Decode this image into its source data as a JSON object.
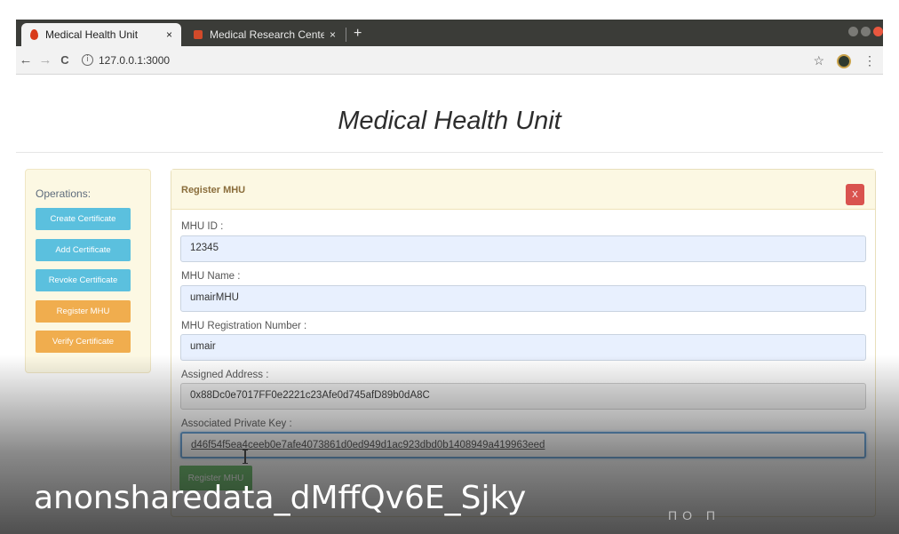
{
  "browser": {
    "tabs": [
      {
        "label": "Medical Health Unit",
        "close": "×",
        "active": true
      },
      {
        "label": "Medical Research Center",
        "close": "×",
        "active": false
      }
    ],
    "new_tab": "+",
    "url": "127.0.0.1:3000",
    "back": "←",
    "forward": "→",
    "reload": "C",
    "info": "i",
    "bookmark": "☆",
    "menu": "⋮"
  },
  "page": {
    "title": "Medical Health Unit"
  },
  "operations": {
    "label": "Operations:",
    "buttons": [
      {
        "label": "Create Certificate",
        "color": "#5bc0de"
      },
      {
        "label": "Add Certificate",
        "color": "#5bc0de"
      },
      {
        "label": "Revoke Certificate",
        "color": "#5bc0de"
      },
      {
        "label": "Register MHU",
        "color": "#f0ad4e"
      },
      {
        "label": "Verify Certificate",
        "color": "#f0ad4e"
      }
    ]
  },
  "form": {
    "title": "Register MHU",
    "close": "X",
    "fields": [
      {
        "label": "MHU ID :",
        "value": "12345"
      },
      {
        "label": "MHU Name :",
        "value": "umairMHU"
      },
      {
        "label": "MHU Registration Number :",
        "value": "umair"
      },
      {
        "label": "Assigned Address :",
        "value": "0x88Dc0e7017FF0e2221c23Afe0d745afD89b0dA8C"
      },
      {
        "label": "Associated Private Key :",
        "value": "d46f54f5ea4ceeb0e7afe4073861d0ed949d1ac923dbd0b1408949a419963eed"
      }
    ],
    "submit": "Register MHU"
  },
  "overlay": {
    "watermark": "anonsharedata_dMffQv6E_Sjky",
    "faint": "ΠΟ Π"
  },
  "colors": {
    "info": "#5bc0de",
    "warning": "#f0ad4e",
    "danger": "#d9534f",
    "success": "#5cb85c",
    "panel_header": "#fcf8e3"
  }
}
